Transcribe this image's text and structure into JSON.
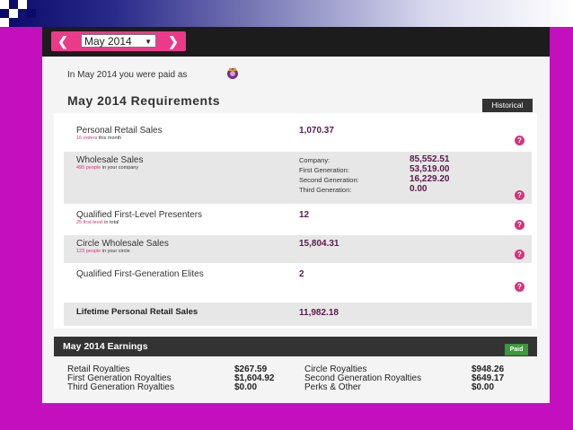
{
  "header": {
    "month_value": "May 2014",
    "prev_icon": "chevron-left-icon",
    "next_icon": "chevron-right-icon"
  },
  "paid_as_text": "In May 2014 you were paid as",
  "requirements_title": "May 2014 Requirements",
  "historical_label": "Historical",
  "requirements": {
    "personal_retail": {
      "label": "Personal Retail Sales",
      "sub_pink": "16 orders",
      "sub_rest": " this month",
      "value": "1,070.37"
    },
    "wholesale": {
      "label": "Wholesale Sales",
      "sub_pink": "495 people",
      "sub_rest": " in your company",
      "breakdown": [
        {
          "label": "Company:",
          "value": "85,552.51"
        },
        {
          "label": "First Generation:",
          "value": "53,519.00"
        },
        {
          "label": "Second Generation:",
          "value": "16,229.20"
        },
        {
          "label": "Third Generation:",
          "value": "0.00"
        }
      ]
    },
    "qualified_presenters": {
      "label": "Qualified First-Level Presenters",
      "sub_pink": "25 first-level",
      "sub_rest": " in total",
      "value": "12"
    },
    "circle_wholesale": {
      "label": "Circle Wholesale Sales",
      "sub_pink": "123 people",
      "sub_rest": " in your circle",
      "value": "15,804.31"
    },
    "qualified_elites": {
      "label": "Qualified First-Generation Elites",
      "value": "2"
    },
    "lifetime": {
      "label": "Lifetime Personal Retail Sales",
      "value": "11,982.18"
    }
  },
  "help_glyph": "?",
  "earnings": {
    "title": "May 2014 Earnings",
    "status": "Paid",
    "left": [
      {
        "label": "Retail Royalties",
        "value": "$267.59"
      },
      {
        "label": "First Generation Royalties",
        "value": "$1,604.92"
      },
      {
        "label": "Third Generation Royalties",
        "value": "$0.00"
      }
    ],
    "right": [
      {
        "label": "Circle Royalties",
        "value": "$948.26"
      },
      {
        "label": "Second Generation Royalties",
        "value": "$649.17"
      },
      {
        "label": "Perks & Other",
        "value": "$0.00"
      }
    ]
  },
  "colors": {
    "accent": "#ec3a8a",
    "background": "#c40fbf",
    "value_text": "#5a1a4a",
    "paid": "#3a9a3a"
  }
}
